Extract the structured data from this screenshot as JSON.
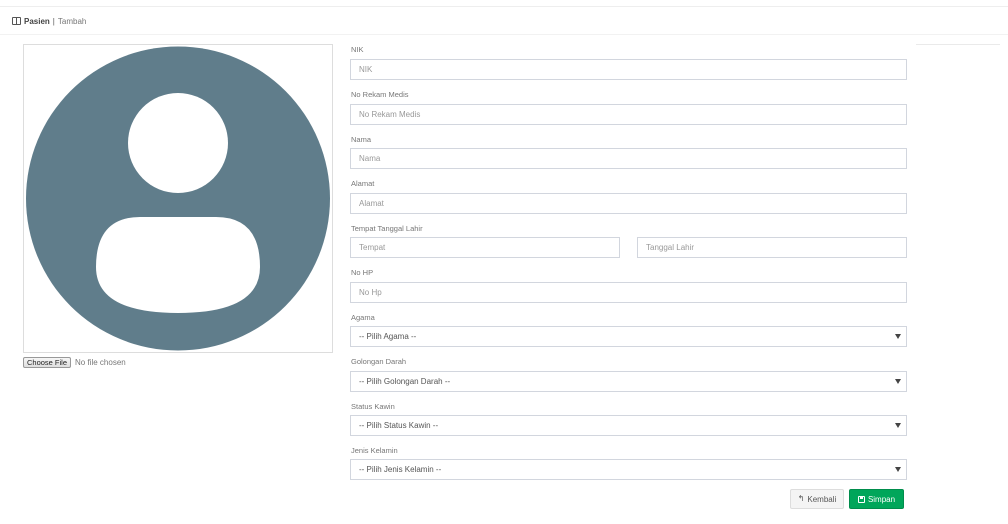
{
  "breadcrumb": {
    "icon": "table-icon",
    "main": "Pasien",
    "separator": "|",
    "sub": "Tambah"
  },
  "photo": {
    "icon": "user-avatar-icon",
    "bg_color": "#607d8b"
  },
  "file_input": {
    "button_label": "Choose File",
    "status": "No file chosen"
  },
  "form": {
    "nik": {
      "label": "NIK",
      "placeholder": "NIK"
    },
    "rekam_medis": {
      "label": "No Rekam Medis",
      "placeholder": "No Rekam Medis"
    },
    "nama": {
      "label": "Nama",
      "placeholder": "Nama"
    },
    "alamat": {
      "label": "Alamat",
      "placeholder": "Alamat"
    },
    "ttl": {
      "label": "Tempat Tanggal Lahir",
      "tempat_placeholder": "Tempat",
      "tanggal_placeholder": "Tanggal Lahir"
    },
    "no_hp": {
      "label": "No HP",
      "placeholder": "No Hp"
    },
    "agama": {
      "label": "Agama",
      "selected": "-- Pilih Agama --"
    },
    "golongan_darah": {
      "label": "Golongan Darah",
      "selected": "-- Pilih Golongan Darah --"
    },
    "status_kawin": {
      "label": "Status Kawin",
      "selected": "-- Pilih Status Kawin --"
    },
    "jenis_kelamin": {
      "label": "Jenis Kelamin",
      "selected": "-- Pilih Jenis Kelamin --"
    }
  },
  "buttons": {
    "back_label": "Kembali",
    "back_icon": "reply-icon",
    "save_label": "Simpan",
    "save_icon": "floppy-disk-icon",
    "save_color": "#00a65a"
  }
}
